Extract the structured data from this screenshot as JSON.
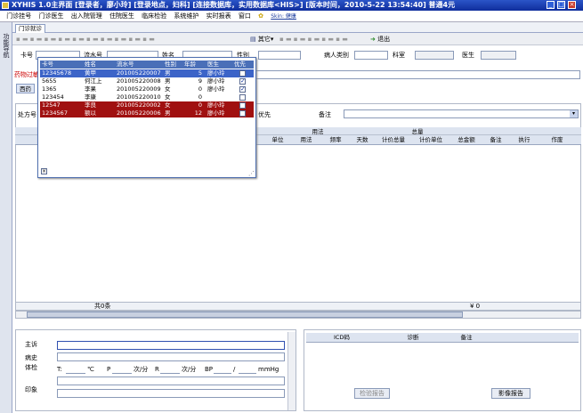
{
  "window": {
    "title": "XYHIS 1.0主界面  [登录者，廖小玲] [登录地点，妇科] [连接数据库，实用数据库<HIS>] [版本时间，2010-5-22 13:54:40] 普通4元"
  },
  "menu": [
    "门诊挂号",
    "门诊医生",
    "出入院管理",
    "住院医生",
    "临床检验",
    "系统维护",
    "实时报表",
    "窗口"
  ],
  "menu_extra": "Skin: 健康",
  "sidebar_label": "功能导航",
  "tab": "门诊就诊",
  "toolbar": {
    "other": "其它",
    "exit": "退出"
  },
  "form": {
    "card_no": "卡号",
    "serial_no": "流水号",
    "name": "姓名",
    "gender": "性别",
    "patient_type": "病人类别",
    "dept": "科室",
    "doctor": "医生"
  },
  "drug_allergy": "药物过敏",
  "med_tab": "西药",
  "rx_no": "处方号",
  "priority": "优先",
  "remark": "备注",
  "grid": {
    "group_usage": "用法",
    "group_total": "总量",
    "cols": [
      "单位",
      "用法",
      "频率",
      "天数",
      "计价总量",
      "计价单位",
      "总金额",
      "备注",
      "执行",
      "作废"
    ]
  },
  "grid_footer": {
    "count": "共0条",
    "amount": "¥ 0"
  },
  "bottom_left": {
    "complaint": "主诉",
    "history": "病史",
    "exam": "体检",
    "impression": "印象",
    "vitals": {
      "t": "T:",
      "t_unit": "℃",
      "p": "P",
      "p_unit": "次/分",
      "r": "R",
      "r_unit": "次/分",
      "bp": "BP",
      "bp_sep": "/",
      "bp_unit": "mmHg"
    }
  },
  "bottom_right": {
    "cols": [
      "ICD码",
      "诊断",
      "备注"
    ],
    "check_report": "检验报告",
    "image_report": "影像报告"
  },
  "popup": {
    "headers": [
      "卡号",
      "姓名",
      "流水号",
      "性别",
      "年龄",
      "医生",
      "优先"
    ],
    "rows": [
      {
        "card": "12345678",
        "name": "黄甲",
        "serial": "201005220007",
        "sex": "男",
        "age": "5",
        "doctor": "廖小玲",
        "priority": false,
        "style": "sel"
      },
      {
        "card": "5655",
        "name": "何江上",
        "serial": "201005220008",
        "sex": "男",
        "age": "9",
        "doctor": "廖小玲",
        "priority": true,
        "style": ""
      },
      {
        "card": "1365",
        "name": "李果",
        "serial": "201005220009",
        "sex": "女",
        "age": "0",
        "doctor": "廖小玲",
        "priority": true,
        "style": ""
      },
      {
        "card": "123454",
        "name": "李康",
        "serial": "201005220010",
        "sex": "女",
        "age": "0",
        "doctor": "",
        "priority": false,
        "style": ""
      },
      {
        "card": "12547",
        "name": "李良",
        "serial": "201005220002",
        "sex": "女",
        "age": "0",
        "doctor": "廖小玲",
        "priority": false,
        "style": "red"
      },
      {
        "card": "1234567",
        "name": "额以",
        "serial": "201005220006",
        "sex": "男",
        "age": "12",
        "doctor": "廖小玲",
        "priority": false,
        "style": "red"
      }
    ]
  },
  "colors": {
    "title_bar": "#1a3fb0",
    "selected_row": "#3c64c8",
    "flag_row": "#a01010",
    "alert_text": "#cc0000"
  }
}
